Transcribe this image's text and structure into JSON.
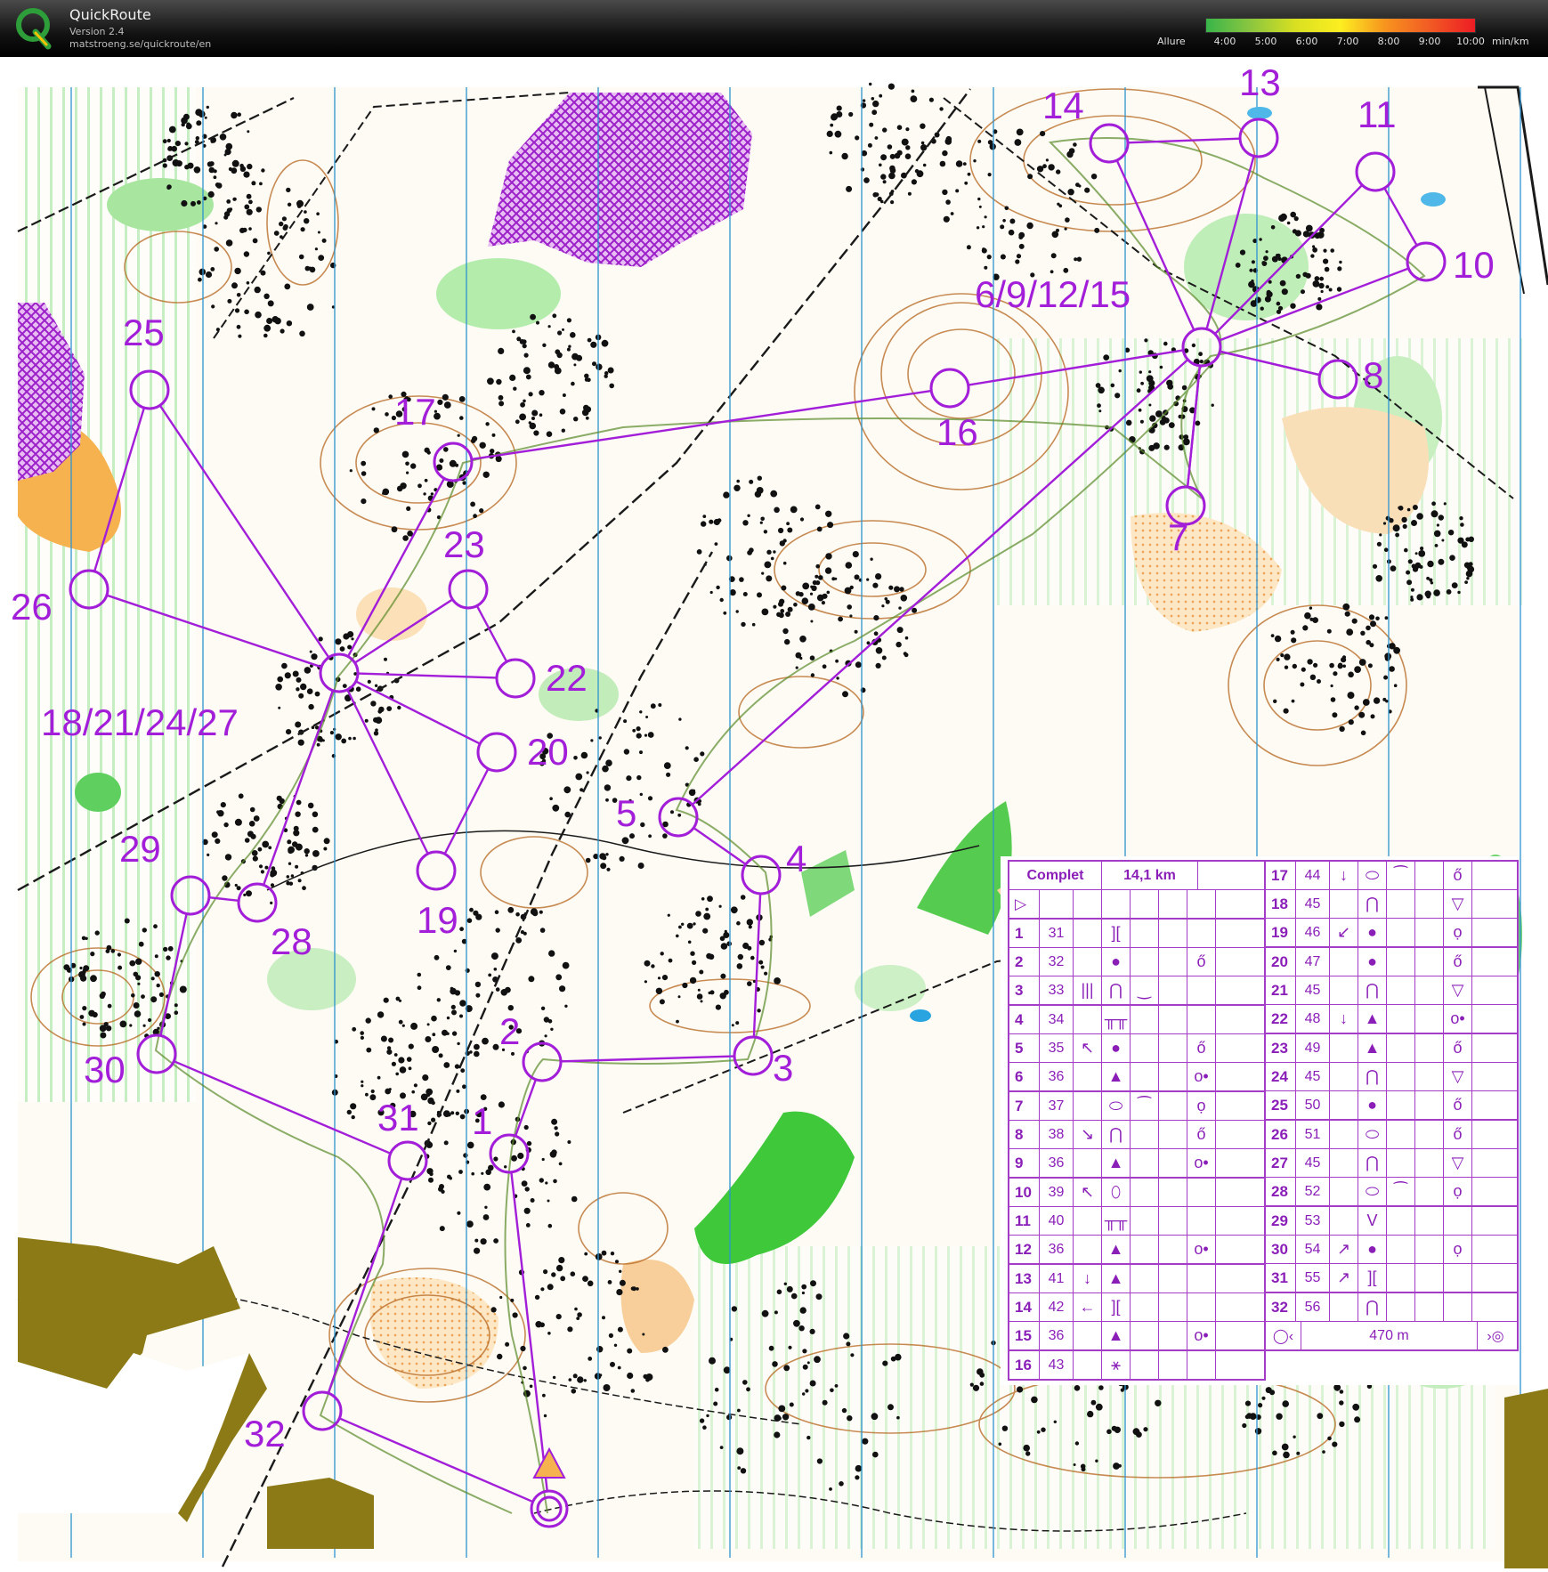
{
  "titlebar": {
    "app_name": "QuickRoute",
    "version": "Version 2.4",
    "url": "matstroeng.se/quickroute/en",
    "pace_legend_label": "Allure",
    "pace_ticks": [
      "4:00",
      "5:00",
      "6:00",
      "7:00",
      "8:00",
      "9:00",
      "10:00"
    ],
    "pace_unit": "min/km",
    "pace_colors": [
      "#39b54a",
      "#8cc63f",
      "#d9e021",
      "#fcee21",
      "#f7931e",
      "#f15a24",
      "#ed1c24"
    ]
  },
  "map": {
    "overprint_color": "#a21ed8",
    "control_labels": [
      {
        "id": "c1",
        "text": "1"
      },
      {
        "id": "c2",
        "text": "2"
      },
      {
        "id": "c3",
        "text": "3"
      },
      {
        "id": "c4",
        "text": "4"
      },
      {
        "id": "c5",
        "text": "5"
      },
      {
        "id": "c6",
        "text": "6/9/12/15"
      },
      {
        "id": "c7",
        "text": "7"
      },
      {
        "id": "c8",
        "text": "8"
      },
      {
        "id": "c10",
        "text": "10"
      },
      {
        "id": "c11",
        "text": "11"
      },
      {
        "id": "c13",
        "text": "13"
      },
      {
        "id": "c14",
        "text": "14"
      },
      {
        "id": "c16",
        "text": "16"
      },
      {
        "id": "c17",
        "text": "17"
      },
      {
        "id": "c18",
        "text": "18/21/24/27"
      },
      {
        "id": "c19",
        "text": "19"
      },
      {
        "id": "c20",
        "text": "20"
      },
      {
        "id": "c22",
        "text": "22"
      },
      {
        "id": "c23",
        "text": "23"
      },
      {
        "id": "c25",
        "text": "25"
      },
      {
        "id": "c26",
        "text": "26"
      },
      {
        "id": "c28",
        "text": "28"
      },
      {
        "id": "c29",
        "text": "29"
      },
      {
        "id": "c30",
        "text": "30"
      },
      {
        "id": "c31",
        "text": "31"
      },
      {
        "id": "c32",
        "text": "32"
      }
    ]
  },
  "description_sheet": {
    "course_name": "Complet",
    "course_length": "14,1 km",
    "finish_distance": "470 m",
    "left_rows": [
      {
        "n": "1",
        "code": "31",
        "dir": "",
        "feature": "][",
        "detail": "",
        "loc": ""
      },
      {
        "n": "2",
        "code": "32",
        "dir": "",
        "feature": "●",
        "detail": "",
        "loc": "ő"
      },
      {
        "n": "3",
        "code": "33",
        "dir": "|||",
        "feature": "⋂",
        "detail": "‿",
        "loc": ""
      },
      {
        "n": "4",
        "code": "34",
        "dir": "",
        "feature": "╥╥",
        "detail": "",
        "loc": ""
      },
      {
        "n": "5",
        "code": "35",
        "dir": "↖",
        "feature": "●",
        "detail": "",
        "loc": "ő"
      },
      {
        "n": "6",
        "code": "36",
        "dir": "",
        "feature": "▲",
        "detail": "",
        "loc": "o•"
      },
      {
        "n": "7",
        "code": "37",
        "dir": "",
        "feature": "⬭",
        "detail": "⁀",
        "loc": "ọ"
      },
      {
        "n": "8",
        "code": "38",
        "dir": "↘",
        "feature": "⋂",
        "detail": "",
        "loc": "ő"
      },
      {
        "n": "9",
        "code": "36",
        "dir": "",
        "feature": "▲",
        "detail": "",
        "loc": "o•"
      },
      {
        "n": "10",
        "code": "39",
        "dir": "↖",
        "feature": "⬯",
        "detail": "",
        "loc": ""
      },
      {
        "n": "11",
        "code": "40",
        "dir": "",
        "feature": "╥╥",
        "detail": "",
        "loc": ""
      },
      {
        "n": "12",
        "code": "36",
        "dir": "",
        "feature": "▲",
        "detail": "",
        "loc": "o•"
      },
      {
        "n": "13",
        "code": "41",
        "dir": "↓",
        "feature": "▲",
        "detail": "",
        "loc": ""
      },
      {
        "n": "14",
        "code": "42",
        "dir": "←",
        "feature": "][",
        "detail": "",
        "loc": ""
      },
      {
        "n": "15",
        "code": "36",
        "dir": "",
        "feature": "▲",
        "detail": "",
        "loc": "o•"
      },
      {
        "n": "16",
        "code": "43",
        "dir": "",
        "feature": "⚹",
        "detail": "",
        "loc": ""
      }
    ],
    "right_rows": [
      {
        "n": "17",
        "code": "44",
        "dir": "↓",
        "feature": "⬭",
        "detail": "⁀",
        "loc": "ő"
      },
      {
        "n": "18",
        "code": "45",
        "dir": "",
        "feature": "⋂",
        "detail": "",
        "loc": "▽"
      },
      {
        "n": "19",
        "code": "46",
        "dir": "↙",
        "feature": "●",
        "detail": "",
        "loc": "ọ"
      },
      {
        "n": "20",
        "code": "47",
        "dir": "",
        "feature": "●",
        "detail": "",
        "loc": "ő"
      },
      {
        "n": "21",
        "code": "45",
        "dir": "",
        "feature": "⋂",
        "detail": "",
        "loc": "▽"
      },
      {
        "n": "22",
        "code": "48",
        "dir": "↓",
        "feature": "▲",
        "detail": "",
        "loc": "o•"
      },
      {
        "n": "23",
        "code": "49",
        "dir": "",
        "feature": "▲",
        "detail": "",
        "loc": "ő"
      },
      {
        "n": "24",
        "code": "45",
        "dir": "",
        "feature": "⋂",
        "detail": "",
        "loc": "▽"
      },
      {
        "n": "25",
        "code": "50",
        "dir": "",
        "feature": "●",
        "detail": "",
        "loc": "ő"
      },
      {
        "n": "26",
        "code": "51",
        "dir": "",
        "feature": "⬭",
        "detail": "",
        "loc": "ő"
      },
      {
        "n": "27",
        "code": "45",
        "dir": "",
        "feature": "⋂",
        "detail": "",
        "loc": "▽"
      },
      {
        "n": "28",
        "code": "52",
        "dir": "",
        "feature": "⬭",
        "detail": "⁀",
        "loc": "ọ"
      },
      {
        "n": "29",
        "code": "53",
        "dir": "",
        "feature": "V",
        "detail": "",
        "loc": ""
      },
      {
        "n": "30",
        "code": "54",
        "dir": "↗",
        "feature": "●",
        "detail": "",
        "loc": "ọ"
      },
      {
        "n": "31",
        "code": "55",
        "dir": "↗",
        "feature": "][",
        "detail": "",
        "loc": ""
      },
      {
        "n": "32",
        "code": "56",
        "dir": "",
        "feature": "⋂",
        "detail": "",
        "loc": ""
      }
    ]
  }
}
